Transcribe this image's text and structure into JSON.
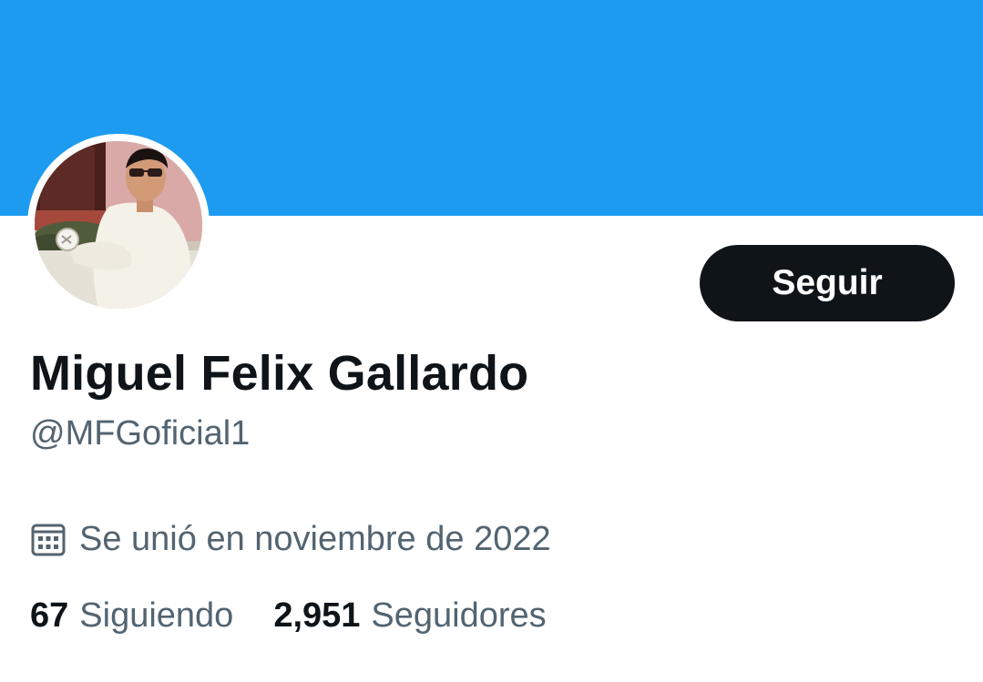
{
  "profile": {
    "display_name": "Miguel Felix Gallardo",
    "handle": "@MFGoficial1",
    "joined": "Se unió en noviembre de 2022",
    "follow_label": "Seguir"
  },
  "stats": {
    "following_count": "67",
    "following_label": "Siguiendo",
    "followers_count": "2,951",
    "followers_label": "Seguidores"
  },
  "colors": {
    "banner": "#1d9bf0",
    "follow_button_bg": "#0f1419",
    "primary_text": "#0f1419",
    "secondary_text": "#536471"
  },
  "icons": {
    "joined": "calendar-icon"
  }
}
